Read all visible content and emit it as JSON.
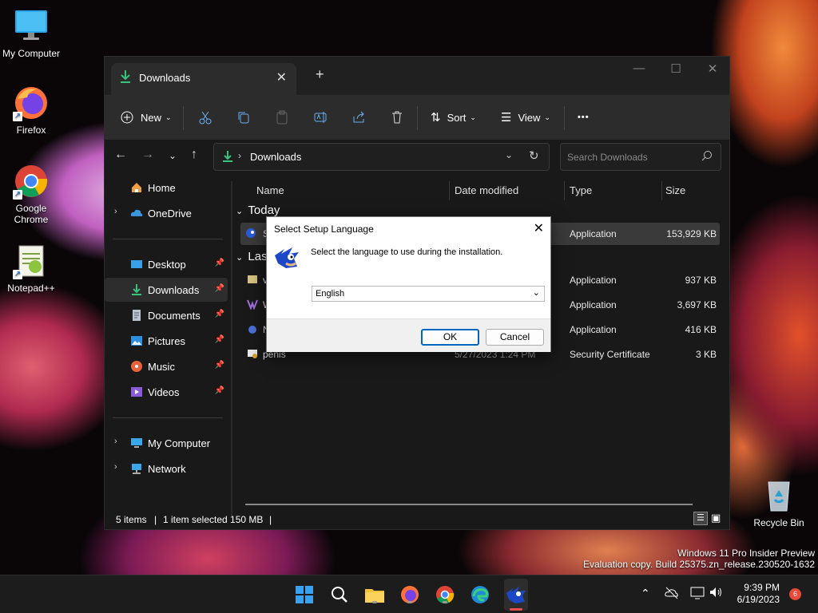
{
  "desktop": {
    "icons": [
      {
        "label": "My Computer"
      },
      {
        "label": "Firefox"
      },
      {
        "label": "Google Chrome"
      },
      {
        "label": "Notepad++"
      },
      {
        "label": "Recycle Bin"
      }
    ],
    "watermark": {
      "line1": "Windows 11 Pro Insider Preview",
      "line2": "Evaluation copy. Build 25375.zn_release.230520-1632"
    }
  },
  "explorer": {
    "tab_title": "Downloads",
    "toolbar": {
      "new_label": "New",
      "sort_label": "Sort",
      "view_label": "View",
      "more_label": "•••"
    },
    "address": {
      "current": "Downloads",
      "search_placeholder": "Search Downloads"
    },
    "sidebar": {
      "home": "Home",
      "onedrive": "OneDrive",
      "desktop": "Desktop",
      "downloads": "Downloads",
      "documents": "Documents",
      "pictures": "Pictures",
      "music": "Music",
      "videos": "Videos",
      "my_computer": "My Computer",
      "network": "Network"
    },
    "columns": {
      "name": "Name",
      "date": "Date modified",
      "type": "Type",
      "size": "Size"
    },
    "groups": {
      "today": "Today",
      "last": "Last"
    },
    "rows": [
      {
        "name": "S",
        "date": "",
        "type": "Application",
        "size": "153,929 KB"
      },
      {
        "name": "v",
        "date": "",
        "type": "Application",
        "size": "937 KB"
      },
      {
        "name": "W",
        "date": "",
        "type": "Application",
        "size": "3,697 KB"
      },
      {
        "name": "N",
        "date": "",
        "type": "Application",
        "size": "416 KB"
      },
      {
        "name": "penis",
        "date": "5/27/2023 1:24 PM",
        "type": "Security Certificate",
        "size": "3 KB"
      }
    ],
    "status": {
      "items": "5 items",
      "selected": "1 item selected 150 MB"
    }
  },
  "dialog": {
    "title": "Select Setup Language",
    "message": "Select the language to use during the installation.",
    "language": "English",
    "ok": "OK",
    "cancel": "Cancel"
  },
  "taskbar": {
    "time": "9:39 PM",
    "date": "6/19/2023",
    "notifications": "6"
  }
}
